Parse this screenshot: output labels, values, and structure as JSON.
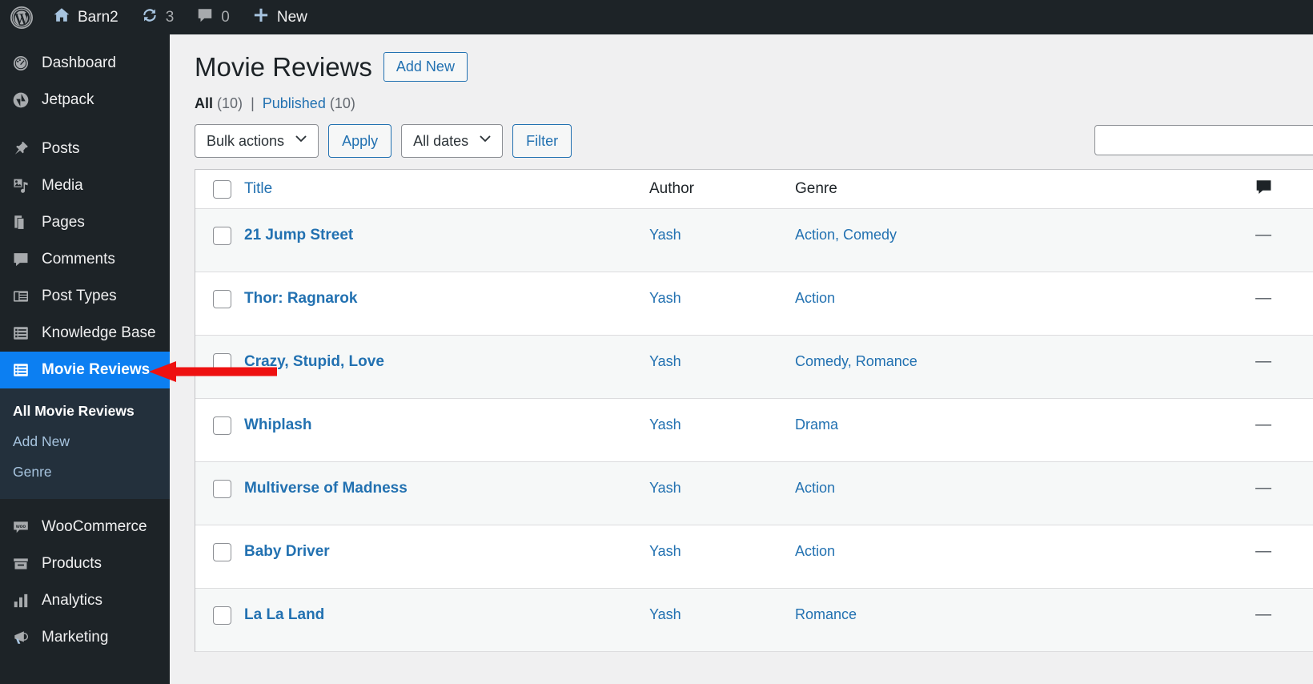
{
  "adminbar": {
    "wp_logo": "wordpress-logo",
    "site_name": "Barn2",
    "updates_count": "3",
    "comments_count": "0",
    "new_label": "New"
  },
  "sidebar": {
    "items": [
      {
        "label": "Dashboard",
        "icon": "dashboard-icon",
        "active": false
      },
      {
        "label": "Jetpack",
        "icon": "jetpack-icon",
        "active": false
      },
      {
        "label": "Posts",
        "icon": "pin-icon",
        "active": false
      },
      {
        "label": "Media",
        "icon": "media-icon",
        "active": false
      },
      {
        "label": "Pages",
        "icon": "pages-icon",
        "active": false
      },
      {
        "label": "Comments",
        "icon": "comment-icon",
        "active": false
      },
      {
        "label": "Post Types",
        "icon": "post-types-icon",
        "active": false
      },
      {
        "label": "Knowledge Base",
        "icon": "knowledge-base-icon",
        "active": false
      },
      {
        "label": "Movie Reviews",
        "icon": "movie-reviews-icon",
        "active": true
      },
      {
        "label": "WooCommerce",
        "icon": "woocommerce-icon",
        "active": false
      },
      {
        "label": "Products",
        "icon": "products-icon",
        "active": false
      },
      {
        "label": "Analytics",
        "icon": "analytics-icon",
        "active": false
      },
      {
        "label": "Marketing",
        "icon": "marketing-icon",
        "active": false
      }
    ],
    "submenu": [
      {
        "label": "All Movie Reviews",
        "current": true
      },
      {
        "label": "Add New",
        "current": false
      },
      {
        "label": "Genre",
        "current": false
      }
    ]
  },
  "page": {
    "title": "Movie Reviews",
    "add_new_label": "Add New"
  },
  "views": {
    "all_label": "All",
    "all_count": "(10)",
    "separator": "|",
    "published_label": "Published",
    "published_count": "(10)"
  },
  "tablenav": {
    "bulk_actions_label": "Bulk actions",
    "apply_label": "Apply",
    "all_dates_label": "All dates",
    "filter_label": "Filter",
    "search_value": "",
    "search_placeholder": ""
  },
  "table": {
    "headers": {
      "title": "Title",
      "author": "Author",
      "genre": "Genre",
      "comments": "comment-bubble-icon"
    },
    "rows": [
      {
        "title": "21 Jump Street",
        "author": "Yash",
        "genre": "Action, Comedy",
        "comments": "—"
      },
      {
        "title": "Thor: Ragnarok",
        "author": "Yash",
        "genre": "Action",
        "comments": "—"
      },
      {
        "title": "Crazy, Stupid, Love",
        "author": "Yash",
        "genre": "Comedy, Romance",
        "comments": "—"
      },
      {
        "title": "Whiplash",
        "author": "Yash",
        "genre": "Drama",
        "comments": "—"
      },
      {
        "title": "Multiverse of Madness",
        "author": "Yash",
        "genre": "Action",
        "comments": "—"
      },
      {
        "title": "Baby Driver",
        "author": "Yash",
        "genre": "Action",
        "comments": "—"
      },
      {
        "title": "La La Land",
        "author": "Yash",
        "genre": "Romance",
        "comments": "—"
      }
    ]
  },
  "annotation": {
    "arrow_color": "#ee1111",
    "arrow_direction": "left",
    "points_at": "Movie Reviews"
  },
  "colors": {
    "sidebar_bg": "#1d2327",
    "submenu_bg": "#23303c",
    "active_menu_bg": "#0c7ff2",
    "link_blue": "#2271b1",
    "content_bg": "#f0f0f1",
    "row_alt_bg": "#f6f8f8"
  }
}
